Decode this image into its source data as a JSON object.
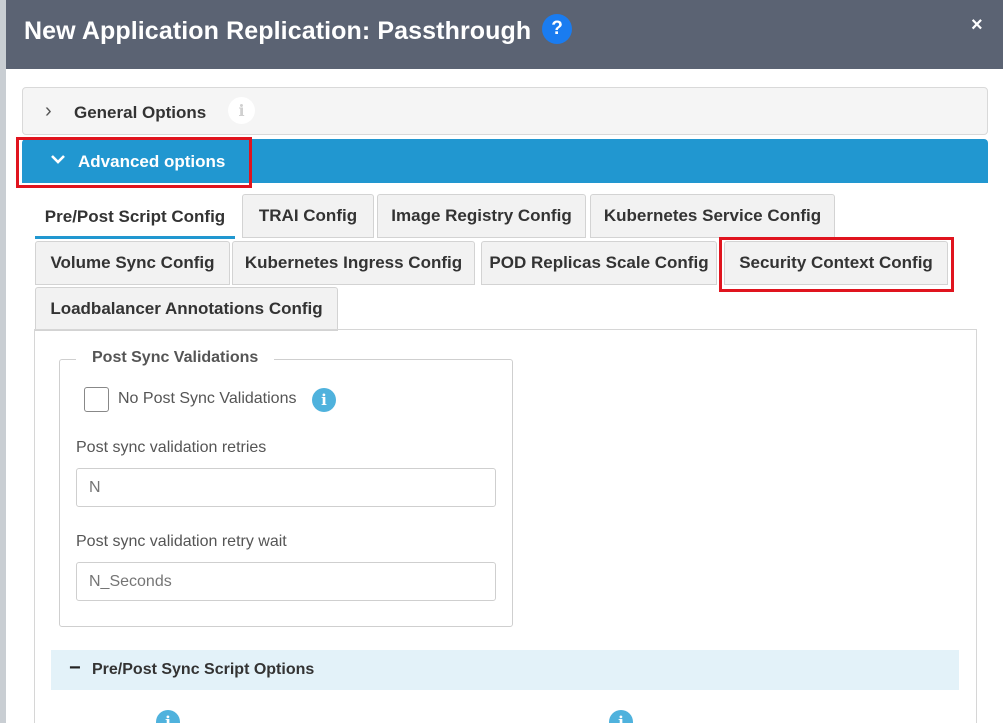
{
  "modal": {
    "title": "New Application Replication: Passthrough",
    "help_glyph": "?",
    "close_glyph": "×"
  },
  "accordion": {
    "general": {
      "label": "General Options",
      "chevron": "›",
      "info_glyph": "i"
    },
    "advanced": {
      "label": "Advanced options",
      "chevron": "⌄"
    }
  },
  "tabs": [
    {
      "label": "Pre/Post Script Config",
      "active": true
    },
    {
      "label": "TRAI Config"
    },
    {
      "label": "Image Registry Config"
    },
    {
      "label": "Kubernetes Service Config"
    },
    {
      "label": "Volume Sync Config"
    },
    {
      "label": "Kubernetes Ingress Config"
    },
    {
      "label": "POD Replicas Scale Config"
    },
    {
      "label": "Security Context Config"
    },
    {
      "label": "Loadbalancer Annotations Config"
    }
  ],
  "post_sync": {
    "legend": "Post Sync Validations",
    "no_validations_label": "No Post Sync Validations",
    "no_validations_checked": false,
    "retries_label": "Post sync validation retries",
    "retries_placeholder": "N",
    "retry_wait_label": "Post sync validation retry wait",
    "retry_wait_placeholder": "N_Seconds",
    "info_glyph": "i"
  },
  "sync_script": {
    "toggle_glyph": "−",
    "label": "Pre/Post Sync Script Options"
  },
  "colors": {
    "header_bg": "#5b6373",
    "accent_blue": "#2197d0",
    "highlight_red": "#e0141e",
    "info_blue": "#4fb2dd"
  }
}
